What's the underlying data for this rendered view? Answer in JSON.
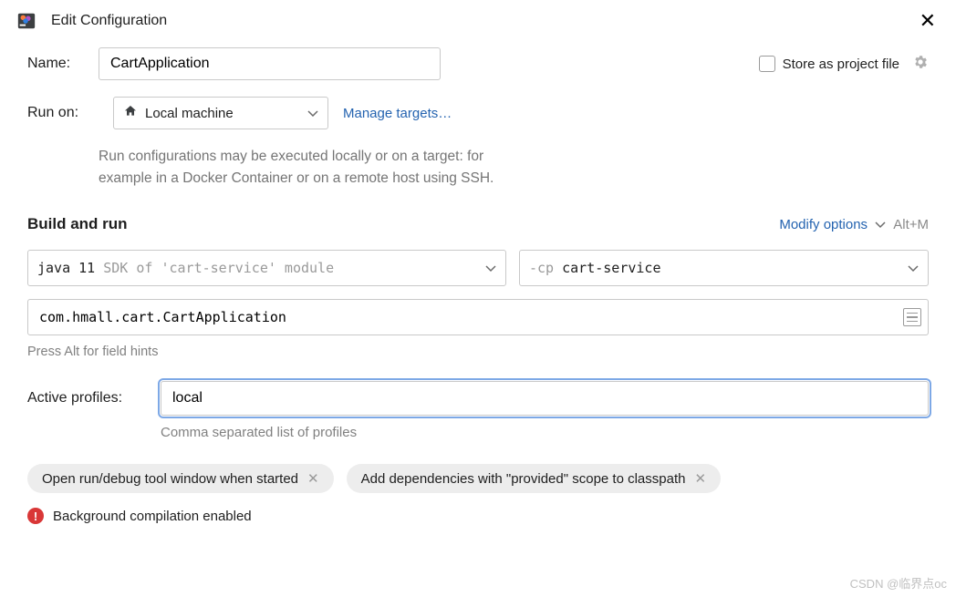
{
  "header": {
    "title": "Edit Configuration"
  },
  "name": {
    "label": "Name:",
    "value": "CartApplication"
  },
  "store": {
    "label": "Store as project file"
  },
  "runOn": {
    "label": "Run on:",
    "value": "Local machine",
    "manageLink": "Manage targets…",
    "hint1": "Run configurations may be executed locally or on a target: for",
    "hint2": "example in a Docker Container or on a remote host using SSH."
  },
  "buildRun": {
    "title": "Build and run",
    "modify": "Modify options",
    "shortcut": "Alt+M",
    "jdk": {
      "prefix": "java 11 ",
      "suffix": "SDK of 'cart-service' module"
    },
    "cp": {
      "prefix": "-cp ",
      "value": "cart-service"
    },
    "mainClass": "com.hmall.cart.CartApplication",
    "fieldHint": "Press Alt for field hints"
  },
  "profiles": {
    "label": "Active profiles:",
    "value": "local",
    "hint": "Comma separated list of profiles"
  },
  "chips": {
    "a": "Open run/debug tool window when started",
    "b": "Add dependencies with \"provided\" scope to classpath"
  },
  "warn": {
    "text": "Background compilation enabled"
  },
  "watermark": "CSDN @临界点oc"
}
